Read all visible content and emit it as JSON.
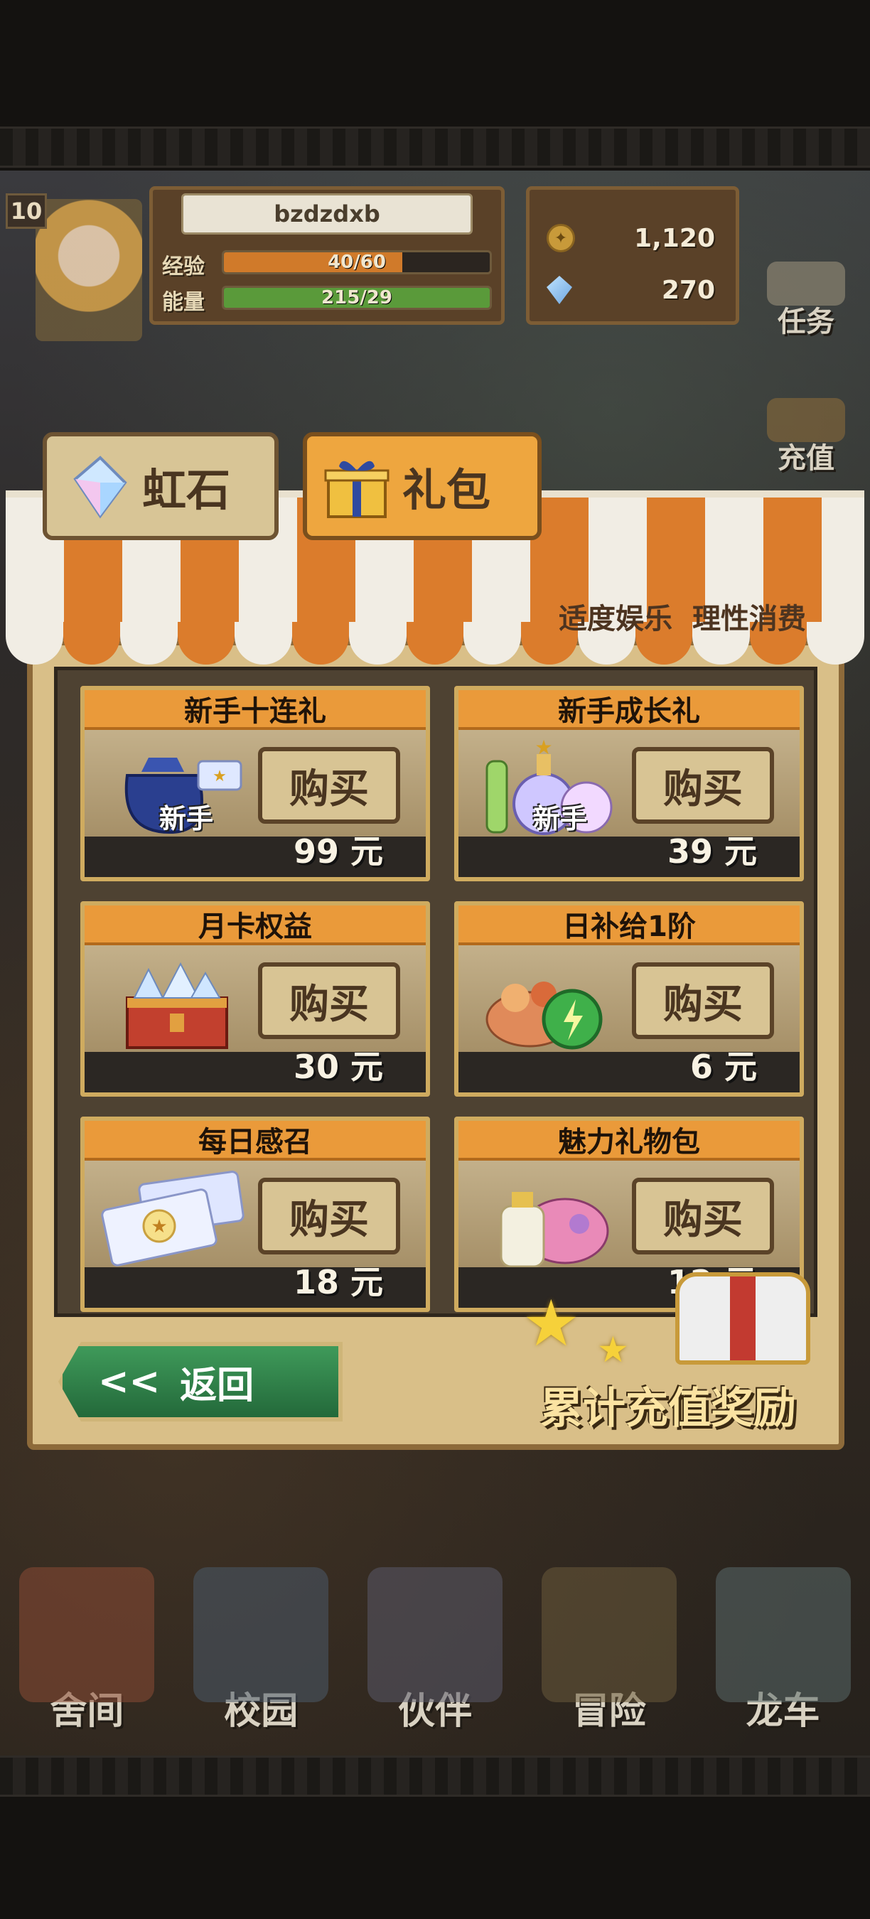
{
  "player": {
    "level": "10",
    "name": "bzdzdxb",
    "exp_label": "经验",
    "exp_text": "40/60",
    "exp_fraction": 0.67,
    "energy_label": "能量",
    "energy_text": "215/29",
    "energy_fraction": 1.0
  },
  "currency": {
    "coins": "1,120",
    "gems": "270"
  },
  "side_buttons": {
    "task": "任务",
    "recharge": "充值"
  },
  "tabs": [
    {
      "label": "虹石",
      "icon": "crystal-icon",
      "active": false
    },
    {
      "label": "礼包",
      "icon": "gift-box-icon",
      "active": true
    }
  ],
  "notice": "适度娱乐 理性消费",
  "buy_label": "购买",
  "newbie_tag": "新手",
  "packages": [
    {
      "title": "新手十连礼",
      "price": "99 元",
      "icon": "summon-bag-icon",
      "newbie": true
    },
    {
      "title": "新手成长礼",
      "price": "39 元",
      "icon": "potion-bottles-icon",
      "newbie": true
    },
    {
      "title": "月卡权益",
      "price": "30 元",
      "icon": "gem-chest-icon",
      "newbie": false
    },
    {
      "title": "日补给1阶",
      "price": "6 元",
      "icon": "energy-food-icon",
      "newbie": false
    },
    {
      "title": "每日感召",
      "price": "18 元",
      "icon": "summon-ticket-icon",
      "newbie": false
    },
    {
      "title": "魅力礼物包",
      "price": "12 元",
      "icon": "charm-gift-icon",
      "newbie": false
    }
  ],
  "back_button": {
    "arrows": "<<",
    "label": "返回"
  },
  "reward_label": "累计充值奖励",
  "nav": [
    {
      "label": "舍间",
      "icon": "house-icon"
    },
    {
      "label": "校园",
      "icon": "campus-icon"
    },
    {
      "label": "伙伴",
      "icon": "partner-icon"
    },
    {
      "label": "冒险",
      "icon": "adventure-icon"
    },
    {
      "label": "龙车",
      "icon": "dragon-cart-icon"
    }
  ],
  "colors": {
    "accent_orange": "#ea9a3a",
    "frame_gold": "#cfab5f",
    "back_green": "#3f9a5a"
  }
}
